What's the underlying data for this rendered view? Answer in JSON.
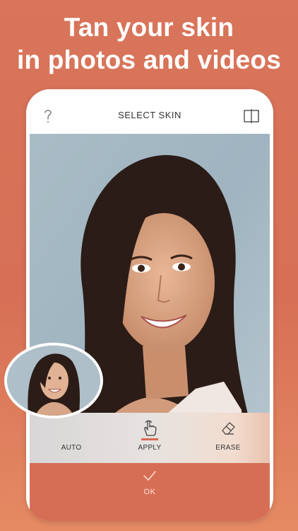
{
  "headline": {
    "line1": "Tan your skin",
    "line2": "in photos and videos"
  },
  "topbar": {
    "help_icon": "question-mark-icon",
    "title": "SELECT SKIN",
    "compare_icon": "split-compare-icon"
  },
  "tools": [
    {
      "label": "AUTO",
      "icon": "none"
    },
    {
      "label": "APPLY",
      "icon": "finger-tap-icon",
      "selected": true
    },
    {
      "label": "ERASE",
      "icon": "eraser-icon"
    }
  ],
  "ok": {
    "label": "OK",
    "icon": "checkmark-icon"
  },
  "colors": {
    "background": "#d8755a",
    "accent": "#d9694f",
    "okbar": "#d66e55"
  }
}
